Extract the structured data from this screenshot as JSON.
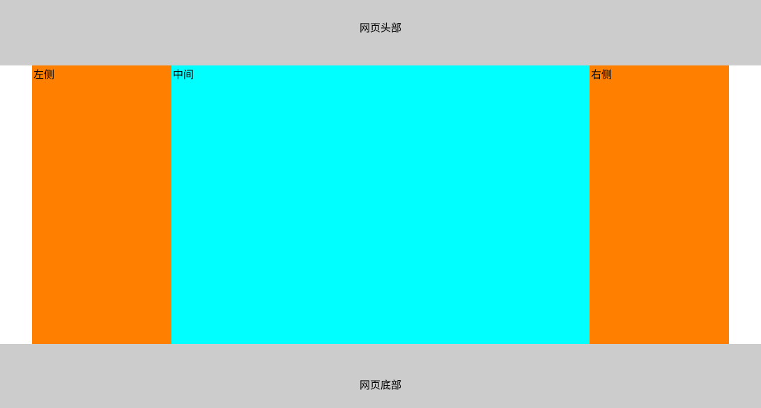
{
  "header": {
    "title": "网页头部"
  },
  "main": {
    "left_label": "左侧",
    "center_label": "中间",
    "right_label": "右侧"
  },
  "footer": {
    "title": "网页底部"
  },
  "colors": {
    "header_bg": "#cccccc",
    "footer_bg": "#cccccc",
    "side_bg": "#ff8000",
    "center_bg": "#00ffff"
  }
}
